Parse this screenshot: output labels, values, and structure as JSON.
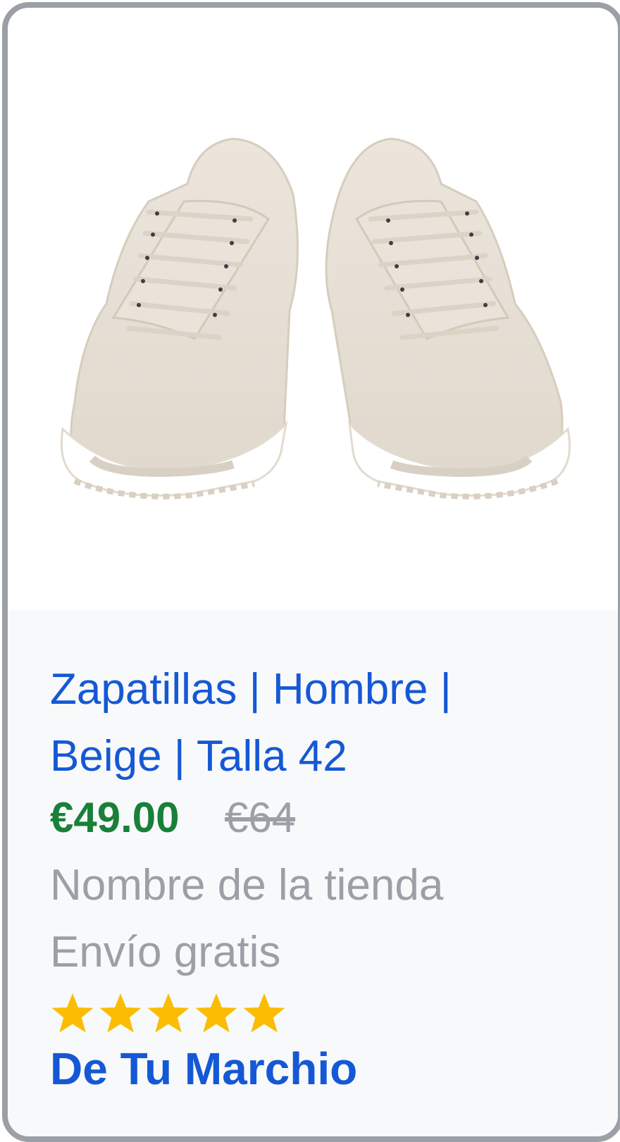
{
  "product": {
    "title_line1": "Zapatillas | Hombre |",
    "title_line2": "Beige | Talla 42",
    "price": "€49.00",
    "original_price": "€64",
    "store_name": "Nombre de la tienda",
    "shipping": "Envío gratis",
    "rating": 5,
    "rating_max": 5,
    "brand": "De Tu Marchio",
    "image_icon": "sneakers-image"
  },
  "colors": {
    "title": "#1558d6",
    "price": "#188038",
    "muted": "#9aa0a6",
    "star": "#fbbc04",
    "border": "#9aa0a6"
  }
}
